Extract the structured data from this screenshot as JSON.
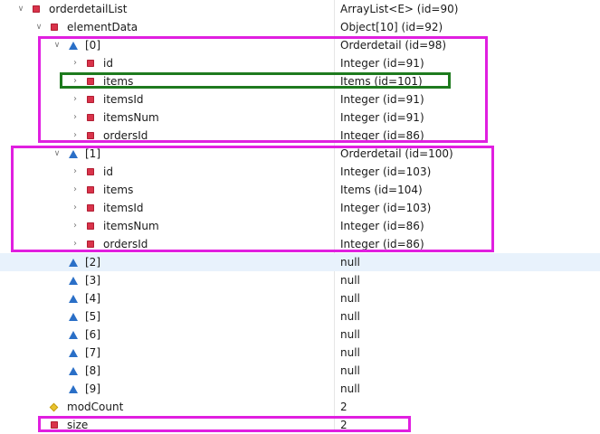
{
  "colors": {
    "selection_row": "#e8f2fc",
    "field_icon": "#d9334a",
    "element_icon": "#2a6fc7",
    "protected_icon": "#e9c22d",
    "highlight_magenta": "#e01fe0",
    "highlight_green": "#1e7a1e"
  },
  "rows": [
    {
      "name": "orderdetailList",
      "value": "ArrayList<E>  (id=90)",
      "icon": "field-icon",
      "expander": "expanded"
    },
    {
      "name": "elementData",
      "value": "Object[10]  (id=92)",
      "icon": "field-icon",
      "expander": "expanded"
    },
    {
      "name": "[0]",
      "value": "Orderdetail  (id=98)",
      "icon": "array-element-icon",
      "expander": "expanded"
    },
    {
      "name": "id",
      "value": "Integer  (id=91)",
      "icon": "field-icon",
      "expander": "collapsed"
    },
    {
      "name": "items",
      "value": "Items  (id=101)",
      "icon": "field-icon",
      "expander": "collapsed"
    },
    {
      "name": "itemsId",
      "value": "Integer  (id=91)",
      "icon": "field-icon",
      "expander": "collapsed"
    },
    {
      "name": "itemsNum",
      "value": "Integer  (id=91)",
      "icon": "field-icon",
      "expander": "collapsed"
    },
    {
      "name": "ordersId",
      "value": "Integer  (id=86)",
      "icon": "field-icon",
      "expander": "collapsed"
    },
    {
      "name": "[1]",
      "value": "Orderdetail  (id=100)",
      "icon": "array-element-icon",
      "expander": "expanded"
    },
    {
      "name": "id",
      "value": "Integer  (id=103)",
      "icon": "field-icon",
      "expander": "collapsed"
    },
    {
      "name": "items",
      "value": "Items  (id=104)",
      "icon": "field-icon",
      "expander": "collapsed"
    },
    {
      "name": "itemsId",
      "value": "Integer  (id=103)",
      "icon": "field-icon",
      "expander": "collapsed"
    },
    {
      "name": "itemsNum",
      "value": "Integer  (id=86)",
      "icon": "field-icon",
      "expander": "collapsed"
    },
    {
      "name": "ordersId",
      "value": "Integer  (id=86)",
      "icon": "field-icon",
      "expander": "collapsed"
    },
    {
      "name": "[2]",
      "value": "null",
      "icon": "array-element-icon",
      "expander": "none",
      "selected": true
    },
    {
      "name": "[3]",
      "value": "null",
      "icon": "array-element-icon",
      "expander": "none"
    },
    {
      "name": "[4]",
      "value": "null",
      "icon": "array-element-icon",
      "expander": "none"
    },
    {
      "name": "[5]",
      "value": "null",
      "icon": "array-element-icon",
      "expander": "none"
    },
    {
      "name": "[6]",
      "value": "null",
      "icon": "array-element-icon",
      "expander": "none"
    },
    {
      "name": "[7]",
      "value": "null",
      "icon": "array-element-icon",
      "expander": "none"
    },
    {
      "name": "[8]",
      "value": "null",
      "icon": "array-element-icon",
      "expander": "none"
    },
    {
      "name": "[9]",
      "value": "null",
      "icon": "array-element-icon",
      "expander": "none"
    },
    {
      "name": "modCount",
      "value": "2",
      "icon": "protected-field-icon",
      "expander": "none"
    },
    {
      "name": "size",
      "value": "2",
      "icon": "field-icon",
      "expander": "none"
    }
  ]
}
